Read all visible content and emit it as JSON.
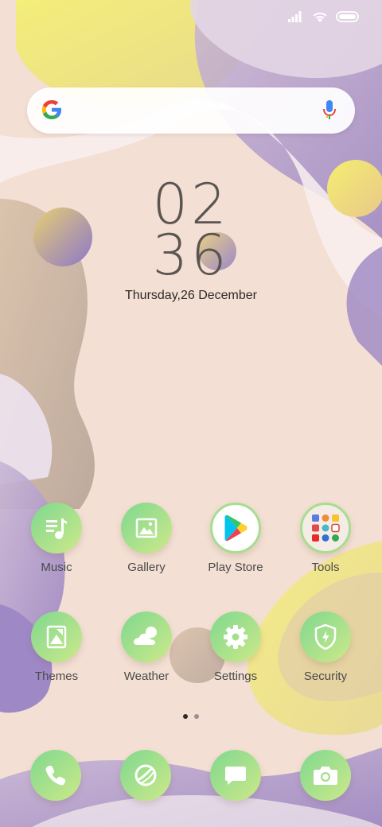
{
  "status_bar": {
    "signal_icon": "signal-icon",
    "wifi_icon": "wifi-icon",
    "battery_icon": "battery-icon"
  },
  "search": {
    "logo_icon": "google-logo-icon",
    "mic_icon": "mic-icon"
  },
  "clock": {
    "hours": "02",
    "minutes": "36",
    "date": "Thursday,26 December"
  },
  "apps_row1": [
    {
      "label": "Music",
      "icon": "music-icon"
    },
    {
      "label": "Gallery",
      "icon": "gallery-icon"
    },
    {
      "label": "Play Store",
      "icon": "play-store-icon"
    },
    {
      "label": "Tools",
      "icon": "folder-icon"
    }
  ],
  "apps_row2": [
    {
      "label": "Themes",
      "icon": "themes-icon"
    },
    {
      "label": "Weather",
      "icon": "weather-icon"
    },
    {
      "label": "Settings",
      "icon": "gear-icon"
    },
    {
      "label": "Security",
      "icon": "shield-icon"
    }
  ],
  "dock": [
    {
      "icon": "phone-icon"
    },
    {
      "icon": "browser-icon"
    },
    {
      "icon": "messages-icon"
    },
    {
      "icon": "camera-icon"
    }
  ],
  "page_indicator": {
    "pages": 2,
    "active": 1
  },
  "colors": {
    "icon_gradient_start": "#7fd88f",
    "icon_gradient_end": "#cde98a",
    "background": "#f3dfd3"
  }
}
